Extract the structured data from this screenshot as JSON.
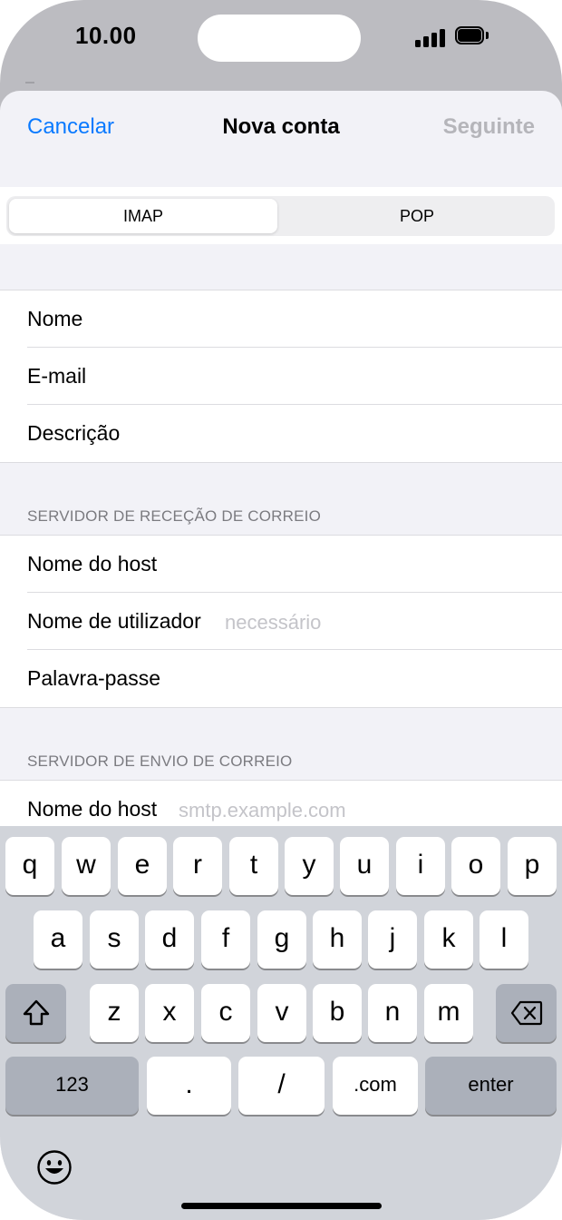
{
  "status_bar": {
    "time": "10.00"
  },
  "nav": {
    "cancel": "Cancelar",
    "title": "Nova conta",
    "next": "Seguinte"
  },
  "segmented": {
    "options": [
      "IMAP",
      "POP"
    ],
    "selected": "IMAP"
  },
  "account": {
    "name_label": "Nome",
    "email_label": "E-mail",
    "description_label": "Descrição"
  },
  "incoming": {
    "header": "SERVIDOR DE RECEÇÃO DE CORREIO",
    "host_label": "Nome do host",
    "user_label": "Nome de utilizador",
    "user_placeholder": "necessário",
    "password_label": "Palavra-passe"
  },
  "outgoing": {
    "header": "SERVIDOR DE ENVIO DE CORREIO",
    "host_label": "Nome do host",
    "host_placeholder": "smtp.example.com"
  },
  "keyboard": {
    "row1": [
      "q",
      "w",
      "e",
      "r",
      "t",
      "y",
      "u",
      "i",
      "o",
      "p"
    ],
    "row2": [
      "a",
      "s",
      "d",
      "f",
      "g",
      "h",
      "j",
      "k",
      "l"
    ],
    "row3": [
      "z",
      "x",
      "c",
      "v",
      "b",
      "n",
      "m"
    ],
    "numbers_key": "123",
    "dot_key": ".",
    "slash_key": "/",
    "dotcom_key": ".com",
    "enter_key": "enter",
    "shift_icon": "shift-icon",
    "delete_icon": "delete-icon",
    "emoji_icon": "emoji-icon"
  },
  "colors": {
    "accent": "#0a7aff",
    "disabled": "#b5b5ba"
  }
}
